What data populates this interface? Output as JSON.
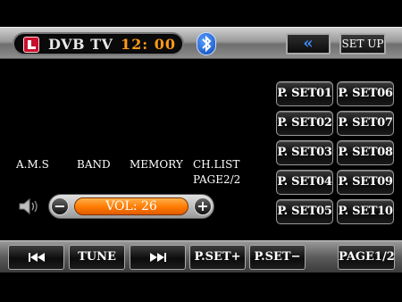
{
  "header": {
    "title": "DVB TV",
    "time": "12: 00",
    "back_label": "«",
    "setup_label": "SET UP"
  },
  "presets": [
    "P. SET01",
    "P. SET02",
    "P. SET03",
    "P. SET04",
    "P. SET05",
    "P. SET06",
    "P. SET07",
    "P. SET08",
    "P. SET09",
    "P. SET10"
  ],
  "labels": {
    "ams": "A.M.S",
    "band": "BAND",
    "memory": "MEMORY",
    "chlist_line1": "CH.LIST",
    "chlist_line2": "PAGE2/2"
  },
  "volume": {
    "display": "VOL: 26",
    "minus": "−",
    "plus": "+"
  },
  "bottom": {
    "tune": "TUNE",
    "pset_plus": "P.SET+",
    "pset_minus": "P.SET−",
    "page": "PAGE1/2"
  },
  "colors": {
    "accent": "#ff7a00",
    "clock": "#ff9a1a",
    "bluetooth": "#0b47b8"
  },
  "icons": [
    "app-icon",
    "bluetooth-icon",
    "speaker-icon",
    "skip-previous-icon",
    "skip-next-icon"
  ]
}
